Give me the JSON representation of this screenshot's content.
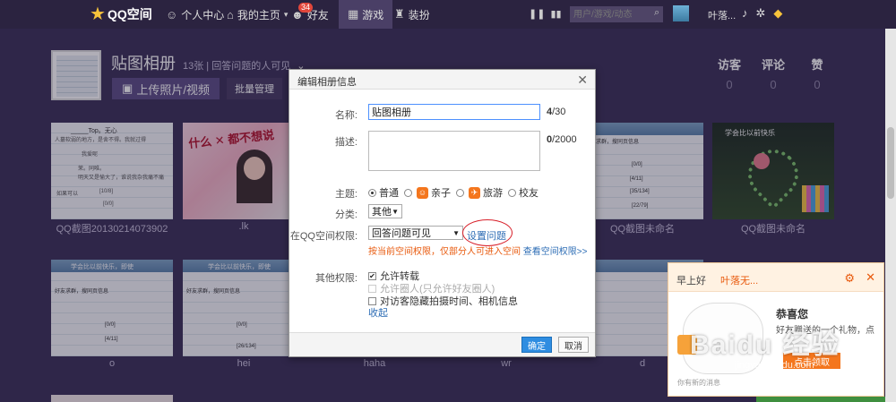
{
  "topbar": {
    "logo": "QQ空间",
    "nav": [
      {
        "label": "个人中心",
        "icon": "person-icon"
      },
      {
        "label": "我的主页",
        "icon": "home-icon"
      },
      {
        "label": "好友",
        "icon": "friends-icon",
        "badge": "34"
      },
      {
        "label": "游戏",
        "icon": "grid-icon"
      },
      {
        "label": "装扮",
        "icon": "shirt-icon"
      }
    ],
    "search_placeholder": "用户/游戏/动态",
    "user": "叶落..."
  },
  "album": {
    "title": "贴图相册",
    "meta": "13张 | 回答问题的人可见",
    "upload_button": "上传照片/视频",
    "manage_button": "批量管理",
    "stats": [
      {
        "label": "访客",
        "value": "0"
      },
      {
        "label": "评论",
        "value": "0"
      },
      {
        "label": "赞",
        "value": "0"
      }
    ]
  },
  "photos": [
    {
      "caption": "QQ截图20130214073902"
    },
    {
      "caption": ".lk"
    },
    {
      "caption": ""
    },
    {
      "caption": ""
    },
    {
      "caption": "QQ截图未命名"
    },
    {
      "caption": "QQ截图未命名"
    },
    {
      "caption": "o"
    },
    {
      "caption": "hei"
    },
    {
      "caption": "haha"
    },
    {
      "caption": "wr"
    },
    {
      "caption": "d"
    }
  ],
  "photo_texts": {
    "p1_title": "_____Top。无心",
    "p1_l1": "人蕞软弱的地方，是舍不得。我就过得",
    "p1_l2": "我爱呢",
    "p1_l3": "茉。同唯。",
    "p1_l4": "明天又是愉大了，谁说我杂我痛不痛",
    "p1_l5": "如果可以",
    "p1_l6": "[10/8]",
    "p1_l7": "[0/0]",
    "p2_text": "什么 ✕ 都不想说",
    "p5_text": "学会比以前快乐",
    "p7_text": "学会比以前快乐，即使",
    "p8_text": "学会比以前快乐，即使",
    "ss_header": "好友求群，搜同页信息",
    "counts": [
      "[0/0]",
      "[4/11]",
      "[35/134]",
      "[22/79]",
      "[26/134]"
    ]
  },
  "modal": {
    "title": "编辑相册信息",
    "name_label": "名称:",
    "name_value": "贴图相册",
    "name_count": "4",
    "name_max": "/30",
    "desc_label": "描述:",
    "desc_count": "0",
    "desc_max": "/2000",
    "theme_label": "主题:",
    "themes": [
      "普通",
      "亲子",
      "旅游",
      "校友"
    ],
    "category_label": "分类:",
    "category_value": "其他",
    "permission_label": "在QQ空间权限:",
    "permission_value": "回答问题可见",
    "set_question_link": "设置问题",
    "tip": "按当前空间权限，仅部分人可进入空间",
    "tip_link": "查看空间权限>>",
    "other_label": "其他权限:",
    "options": [
      {
        "label": "允许转载",
        "checked": true,
        "disabled": false
      },
      {
        "label": "允许圈人(只允许好友圈人)",
        "checked": false,
        "disabled": true
      },
      {
        "label": "对访客隐藏拍摄时间、相机信息",
        "checked": false,
        "disabled": false
      }
    ],
    "collapse_link": "收起",
    "ok_button": "确定",
    "cancel_button": "取消"
  },
  "notify": {
    "greeting": "早上好",
    "user": "叶落无...",
    "congrats": "恭喜您",
    "message": "好友赠送的一个礼物，点",
    "claim_button": "点击领取",
    "footer": "你有新的消息"
  },
  "watermark": {
    "main": "Baidu 经验",
    "sub": "jingyan.baidu.com"
  },
  "colors": {
    "accent": "#2e8de1",
    "warning": "#e8590c",
    "topbar": "#2b2340",
    "background": "#3a2f56"
  }
}
